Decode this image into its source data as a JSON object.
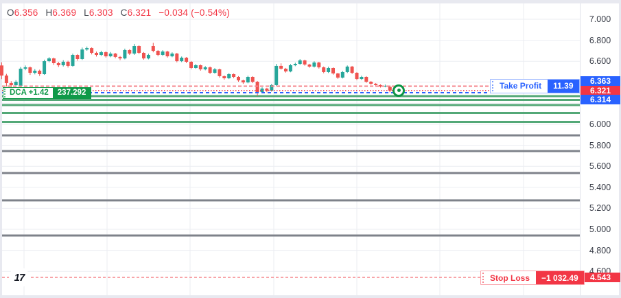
{
  "legend": {
    "o_label": "O",
    "o": "6.356",
    "h_label": "H",
    "h": "6.369",
    "l_label": "L",
    "l": "6.303",
    "c_label": "C",
    "c": "6.321",
    "change": "−0.034 (−0.54%)"
  },
  "trade": {
    "take_profit": {
      "label": "Take Profit",
      "value": "11.39",
      "price": 6.363,
      "price_text": "6.363"
    },
    "stop_loss": {
      "label": "Stop Loss",
      "value": "−1 032.49",
      "price": 4.543,
      "price_text": "4.543"
    },
    "last_price": {
      "price": 6.321,
      "price_text": "6.321"
    },
    "order": {
      "price": 6.314,
      "price_text": "6.314"
    },
    "dca": {
      "label": "DCA +1.42",
      "value": "237.292"
    }
  },
  "price_scale": {
    "ticks": [
      "7.000",
      "6.800",
      "6.600",
      "6.000",
      "5.800",
      "5.600",
      "5.400",
      "5.200",
      "5.000",
      "4.800",
      "4.600"
    ]
  },
  "colors": {
    "up": "#26a69a",
    "down": "#ef5350",
    "blue": "#2962ff",
    "red": "#f23645",
    "pink_dash": "#f5858c",
    "sl_dash": "#f58087",
    "green_level": "#53a877",
    "gray_level": "#7e828a",
    "grid": "#ebedf2",
    "dca_green": "#0f9948"
  },
  "chart_data": {
    "type": "candlestick",
    "title": "",
    "ylim": [
      4.37,
      7.15
    ],
    "grid": true,
    "legend_position": "top-left",
    "price_ticks": [
      7.0,
      6.8,
      6.6,
      6.0,
      5.8,
      5.6,
      5.4,
      5.2,
      5.0,
      4.8,
      4.6
    ],
    "levels": {
      "green": [
        6.268,
        6.232,
        6.183,
        6.108,
        6.023
      ],
      "gray": [
        5.895,
        5.745,
        5.536,
        5.275,
        4.941
      ]
    },
    "lines": {
      "take_profit": 6.363,
      "last_price": 6.321,
      "order": 6.314,
      "stop_loss": 4.543
    },
    "candles": [
      [
        6.56,
        6.59,
        6.43,
        6.464
      ],
      [
        6.464,
        6.48,
        6.36,
        6.392
      ],
      [
        6.392,
        6.41,
        6.34,
        6.372
      ],
      [
        6.372,
        6.42,
        6.355,
        6.405
      ],
      [
        6.365,
        6.545,
        6.345,
        6.529
      ],
      [
        6.529,
        6.56,
        6.515,
        6.542
      ],
      [
        6.542,
        6.55,
        6.47,
        6.49
      ],
      [
        6.49,
        6.525,
        6.475,
        6.51
      ],
      [
        6.51,
        6.52,
        6.46,
        6.477
      ],
      [
        6.477,
        6.615,
        6.47,
        6.601
      ],
      [
        6.601,
        6.64,
        6.59,
        6.627
      ],
      [
        6.627,
        6.635,
        6.565,
        6.582
      ],
      [
        6.582,
        6.595,
        6.545,
        6.562
      ],
      [
        6.562,
        6.61,
        6.55,
        6.595
      ],
      [
        6.595,
        6.605,
        6.54,
        6.556
      ],
      [
        6.556,
        6.672,
        6.548,
        6.66
      ],
      [
        6.66,
        6.668,
        6.605,
        6.621
      ],
      [
        6.621,
        6.73,
        6.612,
        6.712
      ],
      [
        6.712,
        6.74,
        6.7,
        6.725
      ],
      [
        6.725,
        6.732,
        6.665,
        6.68
      ],
      [
        6.68,
        6.692,
        6.645,
        6.66
      ],
      [
        6.66,
        6.7,
        6.65,
        6.686
      ],
      [
        6.686,
        6.695,
        6.635,
        6.647
      ],
      [
        6.647,
        6.688,
        6.638,
        6.673
      ],
      [
        6.673,
        6.68,
        6.628,
        6.641
      ],
      [
        6.641,
        6.65,
        6.61,
        6.627
      ],
      [
        6.627,
        6.72,
        6.618,
        6.706
      ],
      [
        6.706,
        6.715,
        6.66,
        6.673
      ],
      [
        6.673,
        6.765,
        6.66,
        6.745
      ],
      [
        6.745,
        6.752,
        6.668,
        6.68
      ],
      [
        6.68,
        6.688,
        6.615,
        6.627
      ],
      [
        6.627,
        6.672,
        6.618,
        6.66
      ],
      [
        6.745,
        6.775,
        6.685,
        6.699
      ],
      [
        6.699,
        6.706,
        6.648,
        6.66
      ],
      [
        6.66,
        6.705,
        6.652,
        6.693
      ],
      [
        6.693,
        6.7,
        6.635,
        6.647
      ],
      [
        6.647,
        6.685,
        6.638,
        6.673
      ],
      [
        6.673,
        6.68,
        6.59,
        6.601
      ],
      [
        6.601,
        6.645,
        6.592,
        6.634
      ],
      [
        6.634,
        6.64,
        6.582,
        6.595
      ],
      [
        6.595,
        6.602,
        6.524,
        6.536
      ],
      [
        6.536,
        6.574,
        6.528,
        6.562
      ],
      [
        6.562,
        6.57,
        6.51,
        6.523
      ],
      [
        6.523,
        6.554,
        6.514,
        6.542
      ],
      [
        6.542,
        6.55,
        6.478,
        6.49
      ],
      [
        6.49,
        6.535,
        6.482,
        6.523
      ],
      [
        6.523,
        6.53,
        6.445,
        6.458
      ],
      [
        6.458,
        6.465,
        6.425,
        6.438
      ],
      [
        6.438,
        6.488,
        6.43,
        6.477
      ],
      [
        6.477,
        6.484,
        6.438,
        6.451
      ],
      [
        6.451,
        6.458,
        6.405,
        6.418
      ],
      [
        6.418,
        6.425,
        6.385,
        6.399
      ],
      [
        6.399,
        6.462,
        6.39,
        6.451
      ],
      [
        6.451,
        6.458,
        6.392,
        6.405
      ],
      [
        6.405,
        6.412,
        6.27,
        6.307
      ],
      [
        6.307,
        6.352,
        6.298,
        6.34
      ],
      [
        6.34,
        6.348,
        6.305,
        6.32
      ],
      [
        6.32,
        6.385,
        6.312,
        6.373
      ],
      [
        6.373,
        6.575,
        6.365,
        6.556
      ],
      [
        6.556,
        6.58,
        6.52,
        6.529
      ],
      [
        6.529,
        6.537,
        6.492,
        6.503
      ],
      [
        6.503,
        6.574,
        6.495,
        6.562
      ],
      [
        6.562,
        6.586,
        6.553,
        6.575
      ],
      [
        6.575,
        6.62,
        6.566,
        6.608
      ],
      [
        6.608,
        6.615,
        6.558,
        6.569
      ],
      [
        6.569,
        6.576,
        6.538,
        6.549
      ],
      [
        6.549,
        6.6,
        6.54,
        6.588
      ],
      [
        6.588,
        6.595,
        6.53,
        6.542
      ],
      [
        6.542,
        6.55,
        6.486,
        6.497
      ],
      [
        6.497,
        6.548,
        6.488,
        6.536
      ],
      [
        6.536,
        6.542,
        6.472,
        6.484
      ],
      [
        6.484,
        6.49,
        6.432,
        6.444
      ],
      [
        6.444,
        6.508,
        6.436,
        6.497
      ],
      [
        6.497,
        6.56,
        6.488,
        6.549
      ],
      [
        6.549,
        6.556,
        6.478,
        6.49
      ],
      [
        6.49,
        6.496,
        6.42,
        6.431
      ],
      [
        6.431,
        6.462,
        6.422,
        6.451
      ],
      [
        6.451,
        6.458,
        6.394,
        6.405
      ],
      [
        6.405,
        6.412,
        6.375,
        6.386
      ],
      [
        6.386,
        6.392,
        6.362,
        6.373
      ],
      [
        6.373,
        6.38,
        6.35,
        6.36
      ],
      [
        6.36,
        6.378,
        6.352,
        6.366
      ],
      [
        6.356,
        6.369,
        6.303,
        6.321
      ]
    ]
  }
}
